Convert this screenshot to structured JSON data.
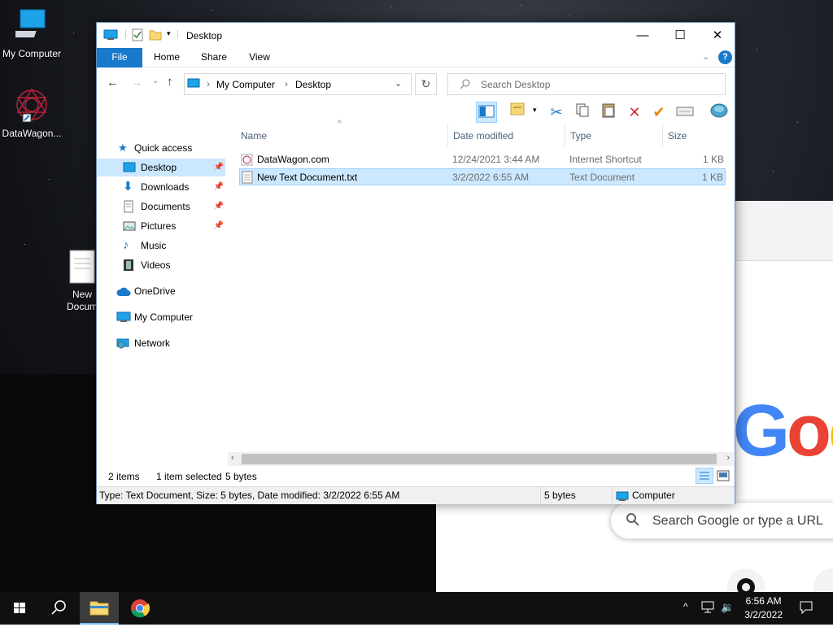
{
  "desktop": {
    "icons": [
      {
        "label": "My Computer"
      },
      {
        "label": "DataWagon..."
      },
      {
        "label": "New\nDocum"
      }
    ]
  },
  "chrome": {
    "logo_text": "Goo",
    "search_placeholder": "Search Google or type a URL"
  },
  "window": {
    "title": "Desktop",
    "controls": {
      "minimize": "—",
      "maximize": "☐",
      "close": "✕"
    },
    "ribbon_tabs": [
      "File",
      "Home",
      "Share",
      "View"
    ],
    "address": {
      "root": "My Computer",
      "current": "Desktop"
    },
    "search_placeholder": "Search Desktop",
    "nav": {
      "quick_access": "Quick access",
      "items": [
        {
          "label": "Desktop",
          "pinned": true,
          "selected": true
        },
        {
          "label": "Downloads",
          "pinned": true
        },
        {
          "label": "Documents",
          "pinned": true
        },
        {
          "label": "Pictures",
          "pinned": true
        },
        {
          "label": "Music",
          "pinned": false
        },
        {
          "label": "Videos",
          "pinned": false
        }
      ],
      "onedrive": "OneDrive",
      "my_computer": "My Computer",
      "network": "Network"
    },
    "columns": [
      "Name",
      "Date modified",
      "Type",
      "Size"
    ],
    "files": [
      {
        "name": "DataWagon.com",
        "date": "12/24/2021 3:44 AM",
        "type": "Internet Shortcut",
        "size": "1 KB",
        "selected": false
      },
      {
        "name": "New Text Document.txt",
        "date": "3/2/2022 6:55 AM",
        "type": "Text Document",
        "size": "1 KB",
        "selected": true
      }
    ],
    "status": {
      "count": "2 items",
      "selected": "1 item selected",
      "size": "5 bytes"
    },
    "details_bar": {
      "info": "Type: Text Document, Size: 5 bytes, Date modified: 3/2/2022 6:55 AM",
      "size": "5 bytes",
      "location": "Computer"
    }
  },
  "taskbar": {
    "time": "6:56 AM",
    "date": "3/2/2022"
  },
  "colors": {
    "accent": "#1979ca",
    "selection": "#cce8ff",
    "folder": "#f8d775"
  }
}
